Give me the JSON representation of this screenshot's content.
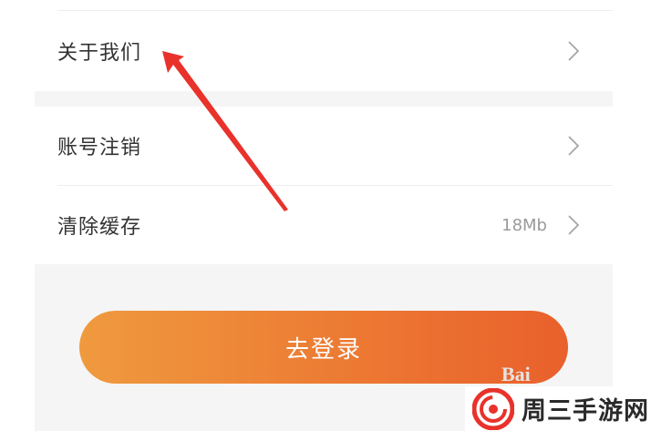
{
  "settings": {
    "items": [
      {
        "label": "关于我们",
        "value": ""
      },
      {
        "label": "账号注销",
        "value": ""
      },
      {
        "label": "清除缓存",
        "value": "18Mb"
      }
    ]
  },
  "login_button": {
    "label": "去登录"
  },
  "watermark": {
    "text": "周三手游网",
    "baidu": "Bai"
  },
  "colors": {
    "accent_start": "#ef9a3f",
    "accent_end": "#e9602c",
    "annotation_arrow": "#e8322b",
    "divider": "#eeeeee",
    "section_gap": "#f5f5f5"
  }
}
